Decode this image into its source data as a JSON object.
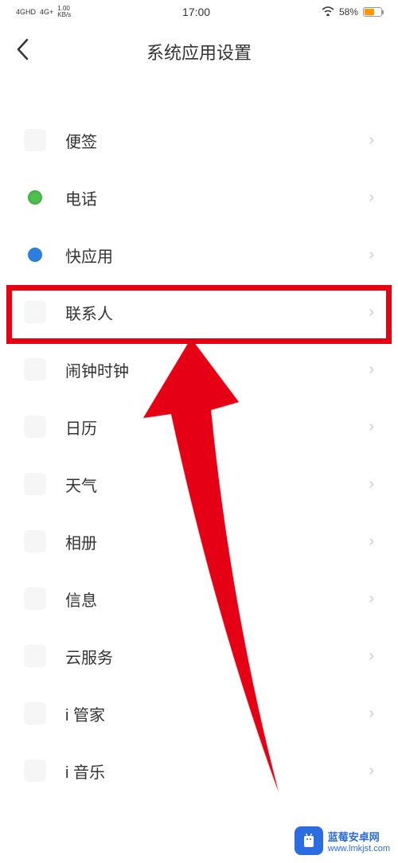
{
  "status": {
    "signal1": "4GHD",
    "signal2": "4G+",
    "speed": "1.00",
    "speed_unit": "KB/s",
    "time": "17:00",
    "battery_pct": "58%"
  },
  "header": {
    "title": "系统应用设置"
  },
  "items": [
    {
      "label": "便签",
      "icon": "notes"
    },
    {
      "label": "电话",
      "icon": "phone"
    },
    {
      "label": "快应用",
      "icon": "quick"
    },
    {
      "label": "联系人",
      "icon": "contacts"
    },
    {
      "label": "闹钟时钟",
      "icon": "clock"
    },
    {
      "label": "日历",
      "icon": "calendar"
    },
    {
      "label": "天气",
      "icon": "weather"
    },
    {
      "label": "相册",
      "icon": "gallery"
    },
    {
      "label": "信息",
      "icon": "messages"
    },
    {
      "label": "云服务",
      "icon": "cloud"
    },
    {
      "label": "i 管家",
      "icon": "imanager"
    },
    {
      "label": "i 音乐",
      "icon": "imusic"
    }
  ],
  "annotation": {
    "highlighted_index": 3,
    "arrow_color": "#e60012"
  },
  "watermark": {
    "title": "蓝莓安卓网",
    "url": "www.lmkjst.com"
  }
}
